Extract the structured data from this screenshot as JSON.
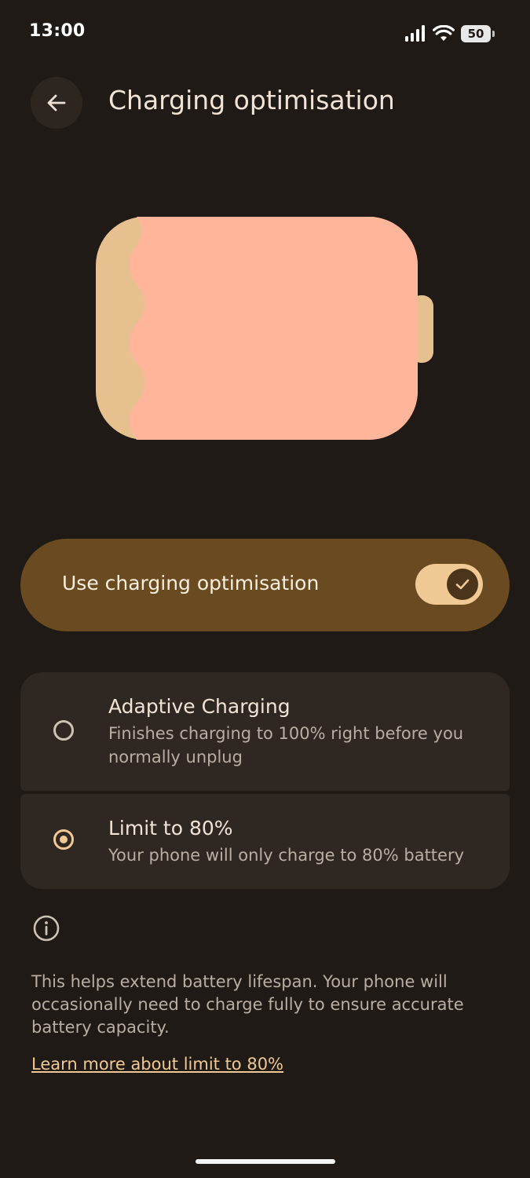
{
  "status_bar": {
    "time": "13:00",
    "battery_level": "50",
    "icons": [
      "signal-icon",
      "wifi-icon",
      "battery-icon"
    ]
  },
  "header": {
    "back_icon": "arrow-left-icon",
    "title": "Charging optimisation"
  },
  "illustration": {
    "name": "battery-illustration",
    "colors": {
      "fill": "#ffb59a",
      "body": "#e6c18f"
    }
  },
  "main_switch": {
    "label": "Use charging optimisation",
    "enabled": true,
    "check_icon": "check-icon"
  },
  "options": [
    {
      "title": "Adaptive Charging",
      "subtitle": "Finishes charging to 100% right before you normally unplug",
      "selected": false
    },
    {
      "title": "Limit to 80%",
      "subtitle": "Your phone will only charge to 80% battery",
      "selected": true
    }
  ],
  "footer": {
    "info_icon": "info-icon",
    "text": "This helps extend battery lifespan. Your phone will occasionally need to charge fully to ensure accurate battery capacity.",
    "link": "Learn more about limit to 80%"
  },
  "colors": {
    "background": "#1f1a16",
    "accent": "#f0c995",
    "switch_card": "#6a4a20",
    "option_card": "#2f2822"
  }
}
